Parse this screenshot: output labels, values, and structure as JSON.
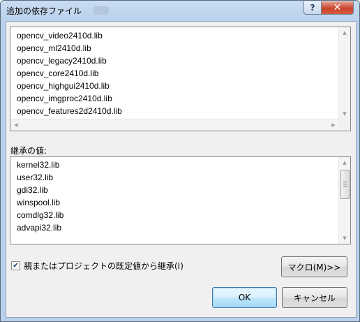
{
  "window": {
    "title": "追加の依存ファイル",
    "help_label": "?",
    "close_label": "✕"
  },
  "dependencies": {
    "items": [
      "opencv_video2410d.lib",
      "opencv_ml2410d.lib",
      "opencv_legacy2410d.lib",
      "opencv_core2410d.lib",
      "opencv_highgui2410d.lib",
      "opencv_imgproc2410d.lib",
      "opencv_features2d2410d.lib"
    ]
  },
  "inherited": {
    "label": "継承の値:",
    "items": [
      "kernel32.lib",
      "user32.lib",
      "gdi32.lib",
      "winspool.lib",
      "comdlg32.lib",
      "advapi32.lib"
    ]
  },
  "inherit_checkbox": {
    "label": "親またはプロジェクトの既定値から継承(I)",
    "checked": true,
    "check_glyph": "✔"
  },
  "buttons": {
    "macro": "マクロ(M)>>",
    "ok": "OK",
    "cancel": "キャンセル"
  },
  "scroll_glyphs": {
    "up": "▲",
    "down": "▼",
    "left": "◀",
    "right": "▶"
  }
}
